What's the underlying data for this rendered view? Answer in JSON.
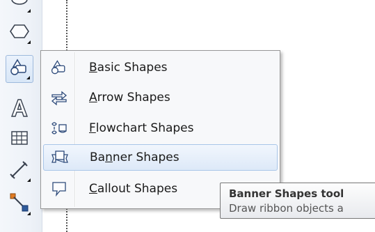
{
  "toolbox": {
    "tools": [
      {
        "icon": "partial-tool-icon"
      },
      {
        "icon": "polygon-tool-icon"
      },
      {
        "icon": "basic-shapes-tool-icon",
        "active": true
      },
      {
        "icon": "text-tool-icon"
      },
      {
        "icon": "table-tool-icon"
      },
      {
        "icon": "dimension-tool-icon"
      },
      {
        "icon": "connector-tool-icon"
      }
    ]
  },
  "menu": {
    "items": [
      {
        "label_acc": "B",
        "label_rest": "asic Shapes",
        "icon": "basic-shapes-icon"
      },
      {
        "label_acc": "A",
        "label_rest": "rrow Shapes",
        "icon": "arrow-shapes-icon"
      },
      {
        "label_acc": "F",
        "label_rest": "lowchart Shapes",
        "icon": "flowchart-shapes-icon"
      },
      {
        "label_pre": "Ba",
        "label_acc": "n",
        "label_rest": "ner Shapes",
        "icon": "banner-shapes-icon",
        "highlighted": true
      },
      {
        "label_acc": "C",
        "label_rest": "allout Shapes",
        "icon": "callout-shapes-icon"
      }
    ]
  },
  "tooltip": {
    "title": "Banner Shapes tool",
    "description": "Draw ribbon objects a"
  },
  "colors": {
    "highlight_border": "#a8c5e8",
    "menu_background": "#f7f8fa",
    "icon_stroke": "#2d4a7a"
  }
}
